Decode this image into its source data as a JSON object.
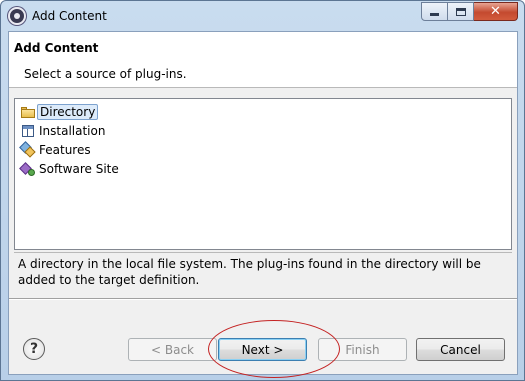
{
  "window": {
    "title": "Add Content",
    "close_glyph": "✕"
  },
  "header": {
    "title": "Add Content",
    "description": "Select a source of plug-ins."
  },
  "sources": [
    {
      "label": "Directory",
      "icon": "folder-icon",
      "selected": true
    },
    {
      "label": "Installation",
      "icon": "installation-icon",
      "selected": false
    },
    {
      "label": "Features",
      "icon": "features-icon",
      "selected": false
    },
    {
      "label": "Software Site",
      "icon": "software-site-icon",
      "selected": false
    }
  ],
  "description_text": "A directory in the local file system. The plug-ins found in the directory will be added to the target definition.",
  "buttons": {
    "help": "?",
    "back": "< Back",
    "next": "Next >",
    "finish": "Finish",
    "cancel": "Cancel"
  },
  "colors": {
    "annotation": "#c42323",
    "selection": "#ddebfa"
  }
}
